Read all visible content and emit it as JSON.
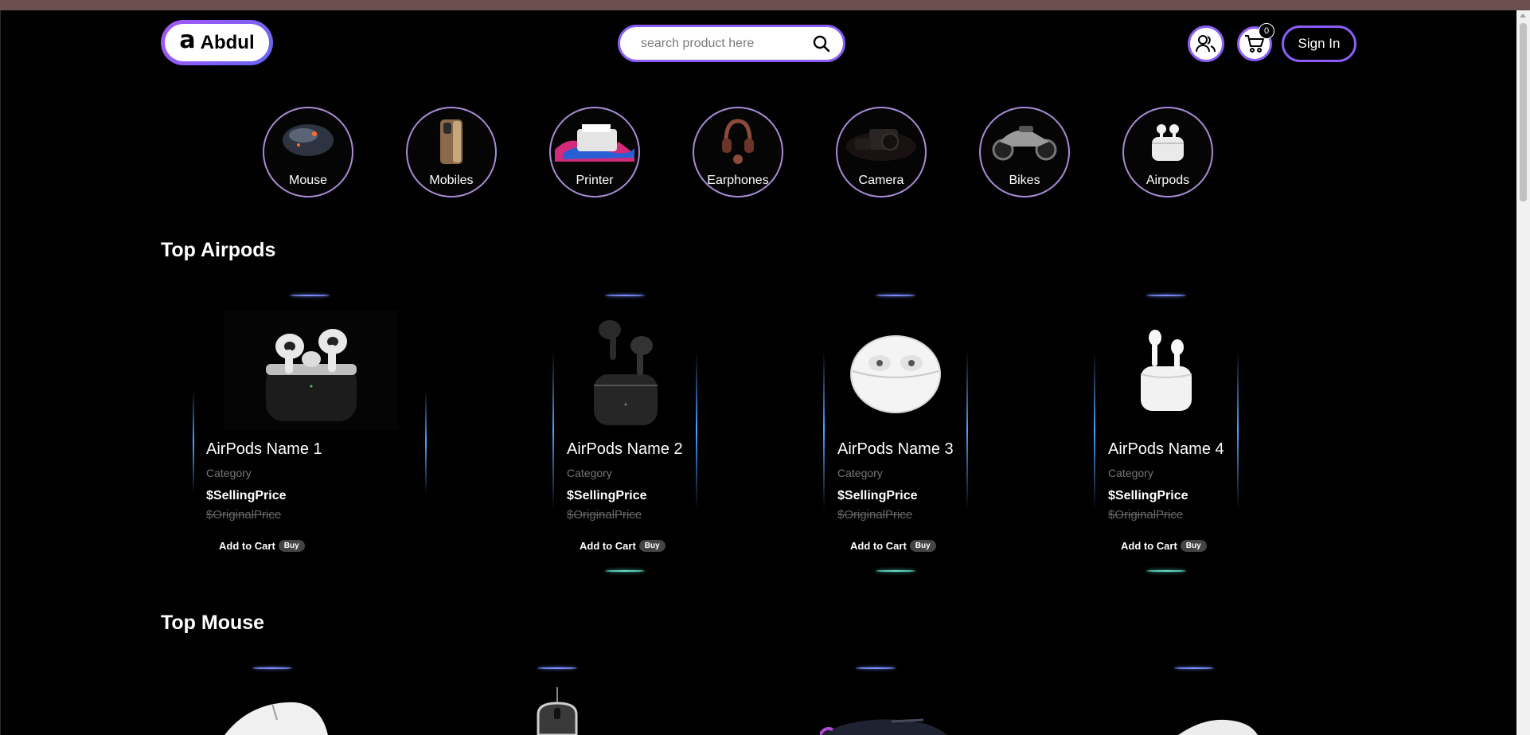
{
  "brand": {
    "glyph": "a",
    "name": "Abdul"
  },
  "search": {
    "placeholder": "search product here"
  },
  "header": {
    "cart_count": "0",
    "signin_label": "Sign In"
  },
  "categories": [
    {
      "label": "Mouse"
    },
    {
      "label": "Mobiles"
    },
    {
      "label": "Printer"
    },
    {
      "label": "Earphones"
    },
    {
      "label": "Camera"
    },
    {
      "label": "Bikes"
    },
    {
      "label": "Airpods"
    }
  ],
  "sections": [
    {
      "title": "Top Airpods",
      "products": [
        {
          "name": "AirPods Name 1",
          "category": "Category",
          "selling": "$SellingPrice",
          "original": "$OriginalPrice",
          "add_label": "Add to Cart",
          "buy_label": "Buy"
        },
        {
          "name": "AirPods Name 2",
          "category": "Category",
          "selling": "$SellingPrice",
          "original": "$OriginalPrice",
          "add_label": "Add to Cart",
          "buy_label": "Buy"
        },
        {
          "name": "AirPods Name 3",
          "category": "Category",
          "selling": "$SellingPrice",
          "original": "$OriginalPrice",
          "add_label": "Add to Cart",
          "buy_label": "Buy"
        },
        {
          "name": "AirPods Name 4",
          "category": "Category",
          "selling": "$SellingPrice",
          "original": "$OriginalPrice",
          "add_label": "Add to Cart",
          "buy_label": "Buy"
        }
      ]
    },
    {
      "title": "Top Mouse"
    }
  ],
  "colors": {
    "accent": "#8b5cf6",
    "background": "#000000",
    "top_strip": "#6b4f4f",
    "glow_top": "#7a8cff",
    "glow_bottom": "#5fe0c9"
  }
}
